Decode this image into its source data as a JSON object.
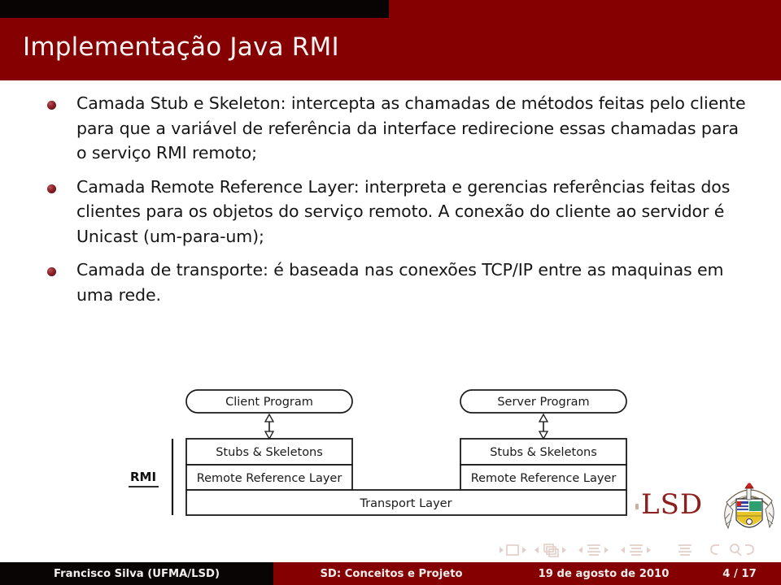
{
  "slide": {
    "title": "Implementação Java RMI",
    "accent_color": "#850000",
    "dark_color": "#0a0505",
    "bullets": [
      "Camada Stub e Skeleton: intercepta as chamadas de métodos feitas pelo cliente para que a variável de referência da interface redirecione essas chamadas para o serviço RMI remoto;",
      "Camada Remote Reference Layer: interpreta e gerencias referências feitas dos clientes para os objetos do serviço remoto. A conexão do cliente ao servidor é Unicast (um-para-um);",
      "Camada de transporte: é baseada nas conexões TCP/IP entre as maquinas em uma rede."
    ]
  },
  "diagram": {
    "group_label": "RMI",
    "client_program": "Client Program",
    "server_program": "Server Program",
    "client_stubs": "Stubs & Skeletons",
    "client_rrl": "Remote Reference Layer",
    "server_stubs": "Stubs & Skeletons",
    "server_rrl": "Remote Reference Layer",
    "transport": "Transport Layer"
  },
  "logo": {
    "text": "LSD",
    "color": "#8c2020"
  },
  "nav_symbols": [
    "prev-slide-icon",
    "slide-icon",
    "next-slide-icon",
    "prev-frame-icon",
    "frame-icon",
    "next-frame-icon",
    "prev-subsection-icon",
    "subsection-icon",
    "next-subsection-icon",
    "prev-section-icon",
    "section-icon",
    "next-section-icon",
    "doc-icon",
    "back-icon",
    "search-icon",
    "forward-icon"
  ],
  "footer": {
    "author": "Francisco Silva  (UFMA/LSD)",
    "title": "SD: Conceitos e Projeto",
    "date": "19 de agosto de 2010",
    "page": "4 / 17"
  }
}
